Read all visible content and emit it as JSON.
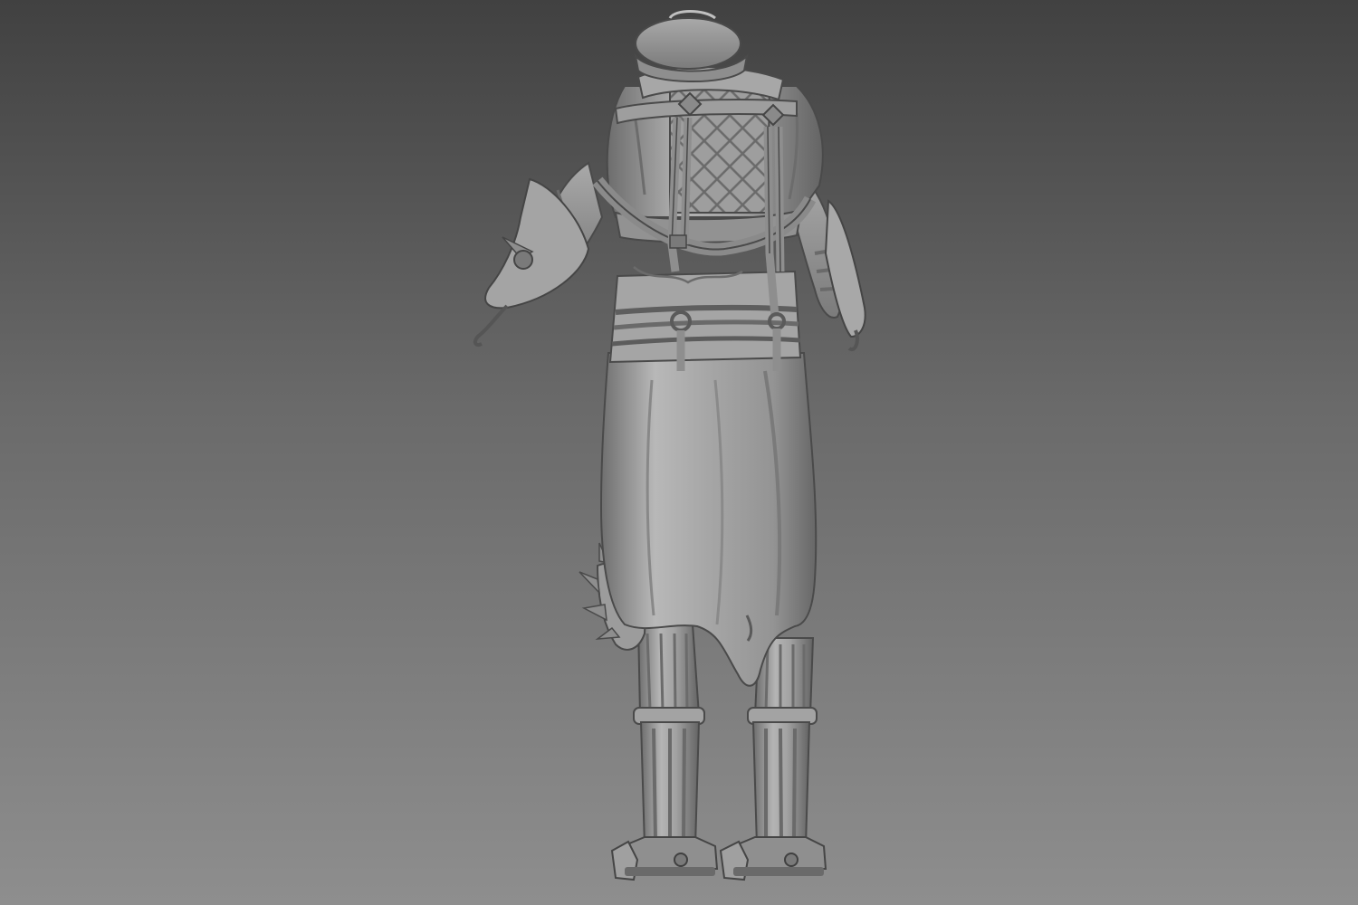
{
  "scene": {
    "subject": "sculpted-character-back-view",
    "background": {
      "top": "#414141",
      "middle": "#6a6a6a",
      "bottom": "#8e8e8e"
    },
    "material": {
      "base": "#9b9b9b",
      "highlight": "#c4c4c4",
      "mid": "#858585",
      "shadow": "#4e4e4e",
      "outline": "#3a3a3a"
    }
  }
}
